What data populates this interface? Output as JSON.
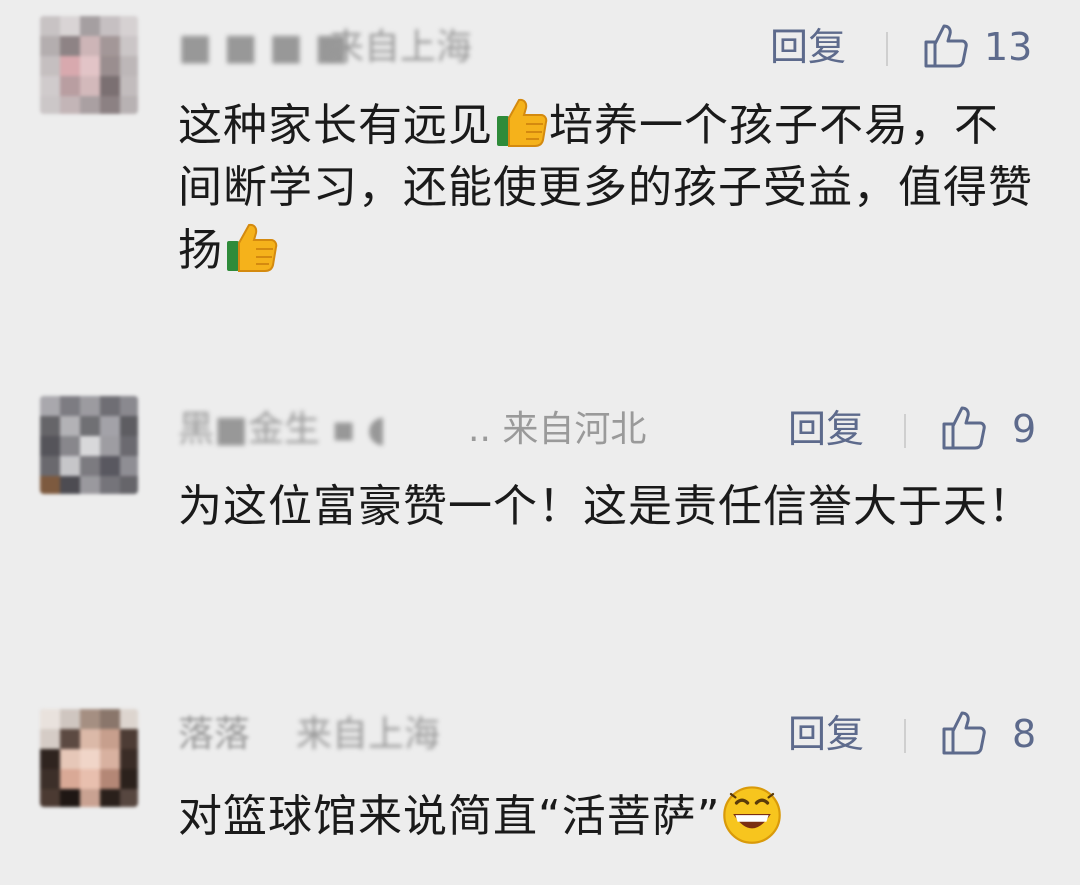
{
  "comments": [
    {
      "name": "■ ■ ■ ■",
      "location": "来自上海",
      "reply_label": "回复",
      "likes": "13",
      "text_parts": [
        "这种家长有远见",
        "培养一个孩子不易，不间断学习，还能使更多的孩子受益，值得赞扬"
      ],
      "emojis": [
        "thumbs-up-emoji",
        "thumbs-up-emoji"
      ]
    },
    {
      "name": "黑■金生 ▪ ◖",
      "location": ".. 来自河北",
      "reply_label": "回复",
      "likes": "9",
      "text": "为这位富豪赞一个！这是责任信誉大于天！"
    },
    {
      "name": "落落",
      "location": "来自上海",
      "reply_label": "回复",
      "likes": "8",
      "text_before_emoji": "对篮球馆来说简直“活菩萨”",
      "emoji": "grinning-face-emoji"
    }
  ],
  "colors": {
    "background": "#ededed",
    "name_gray": "#8a8a8a",
    "action_blue_gray": "#5d6a8c",
    "text": "#1a1a1a"
  }
}
